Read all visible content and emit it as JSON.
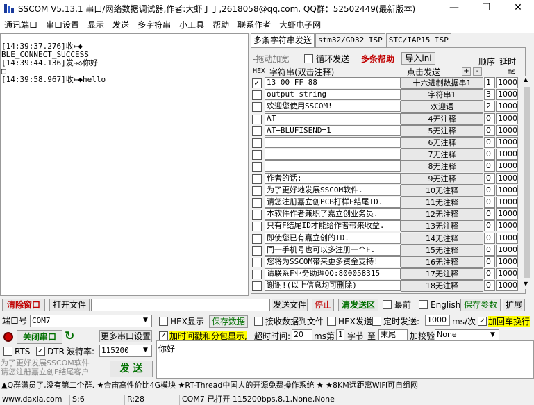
{
  "window": {
    "title": "SSCOM V5.13.1 串口/网络数据调试器,作者:大虾丁丁,2618058@qq.com. QQ群：52502449(最新版本)",
    "minimize": "—",
    "maximize": "☐",
    "close": "✕"
  },
  "menu": [
    "通讯端口",
    "串口设置",
    "显示",
    "发送",
    "多字符串",
    "小工具",
    "帮助",
    "联系作者",
    "大虾电子网"
  ],
  "receive": {
    "lines": [
      "[14:39:37.276]收←◆",
      "BLE_CONNECT_SUCCESS",
      "",
      "[14:39:44.136]发→◇你好",
      "□",
      "[14:39:58.967]收←◆hello"
    ]
  },
  "tabs": [
    "多条字符串发送",
    "stm32/GD32 ISP",
    "STC/IAP15 ISP"
  ],
  "multi": {
    "drag_label": "-拖动加宽",
    "loop_label": "循环发送",
    "help_label": "多条帮助",
    "import_label": "导入ini",
    "order_label": "顺序",
    "delay_label": "延时",
    "hex_label": "HEX",
    "string_label": "字符串(双击注释)",
    "click_send_label": "点击发送",
    "plus": "+",
    "minus": "-",
    "ms_label": "ms",
    "rows": [
      {
        "checked": true,
        "text": "13 00 FF 88",
        "button": "十六进制数据串1",
        "order": "1",
        "delay": "1000"
      },
      {
        "checked": false,
        "text": "output string",
        "button": "字符串1",
        "order": "3",
        "delay": "1000"
      },
      {
        "checked": false,
        "text": "欢迎您使用SSCOM!",
        "button": "欢迎语",
        "order": "2",
        "delay": "1000"
      },
      {
        "checked": false,
        "text": "AT",
        "button": "4无注释",
        "order": "0",
        "delay": "1000"
      },
      {
        "checked": false,
        "text": "AT+BLUFISEND=1",
        "button": "5无注释",
        "order": "0",
        "delay": "1000"
      },
      {
        "checked": false,
        "text": "",
        "button": "6无注释",
        "order": "0",
        "delay": "1000"
      },
      {
        "checked": false,
        "text": "",
        "button": "7无注释",
        "order": "0",
        "delay": "1000"
      },
      {
        "checked": false,
        "text": "",
        "button": "8无注释",
        "order": "0",
        "delay": "1000"
      },
      {
        "checked": false,
        "text": "作者的话:",
        "button": "9无注释",
        "order": "0",
        "delay": "1000"
      },
      {
        "checked": false,
        "text": "为了更好地发展SSCOM软件.",
        "button": "10无注释",
        "order": "0",
        "delay": "1000"
      },
      {
        "checked": false,
        "text": "请您注册嘉立创PCB打样F结尾ID.",
        "button": "11无注释",
        "order": "0",
        "delay": "1000"
      },
      {
        "checked": false,
        "text": "本软件作者兼职了嘉立创业务员.",
        "button": "12无注释",
        "order": "0",
        "delay": "1000"
      },
      {
        "checked": false,
        "text": "只有F结尾ID才能给作者带来收益.",
        "button": "13无注释",
        "order": "0",
        "delay": "1000"
      },
      {
        "checked": false,
        "text": "即使您已有嘉立创的ID.",
        "button": "14无注释",
        "order": "0",
        "delay": "1000"
      },
      {
        "checked": false,
        "text": "同一手机号也可以多注册一个F.",
        "button": "15无注释",
        "order": "0",
        "delay": "1000"
      },
      {
        "checked": false,
        "text": "您将为SSCOM带来更多资金支持!",
        "button": "16无注释",
        "order": "0",
        "delay": "1000"
      },
      {
        "checked": false,
        "text": "请联系F业务助理QQ:800058315",
        "button": "17无注释",
        "order": "0",
        "delay": "1000"
      },
      {
        "checked": false,
        "text": "谢谢!(以上信息均可删除)",
        "button": "18无注释",
        "order": "0",
        "delay": "1000"
      }
    ]
  },
  "toolbar1": {
    "clear_window": "清除窗口",
    "open_file": "打开文件",
    "file_path": "",
    "send_file": "发送文件",
    "stop": "停止",
    "clear_send": "清发送区",
    "topmost": "最前",
    "english": "English",
    "save_params": "保存参数",
    "expand": "扩展"
  },
  "toolbar2": {
    "port_label": "端口号",
    "port_value": "COM7",
    "hex_display": "HEX显示",
    "save_data": "保存数据",
    "recv_to_file": "接收数据到文件",
    "hex_send": "HEX发送",
    "timed_send": "定时发送:",
    "interval": "1000",
    "interval_unit": "ms/次",
    "append_crlf": "加回车换行"
  },
  "toolbar3": {
    "close_port": "关闭串口",
    "more_settings": "更多串口设置",
    "timestamp": "加时间戳和分包显示,",
    "timeout_label": "超时时间:",
    "timeout": "20",
    "ms": "ms",
    "nth_label": "第",
    "nth_value": "1",
    "byte_label": "字节",
    "to_label": "至",
    "end_value": "末尾",
    "checksum_label": "加校验",
    "checksum_value": "None"
  },
  "toolbar4": {
    "rts": "RTS",
    "dtr": "DTR",
    "baud_label": "波特率:",
    "baud_value": "115200",
    "promo1": "为了更好发展SSCOM软件",
    "promo2": "请您注册嘉立创F结尾客户",
    "send": "发 送",
    "send_text": "你好"
  },
  "ticker": "▲Q群满员了,没有第二个群. ★合宙高性价比4G模块 ★RT-Thread中国人的开源免费操作系统 ★ ★8KM远距离WiFi可自组网",
  "status": {
    "site": "www.daxia.com",
    "s": "S:6",
    "r": "R:28",
    "port_status": "COM7 已打开  115200bps,8,1,None,None"
  }
}
